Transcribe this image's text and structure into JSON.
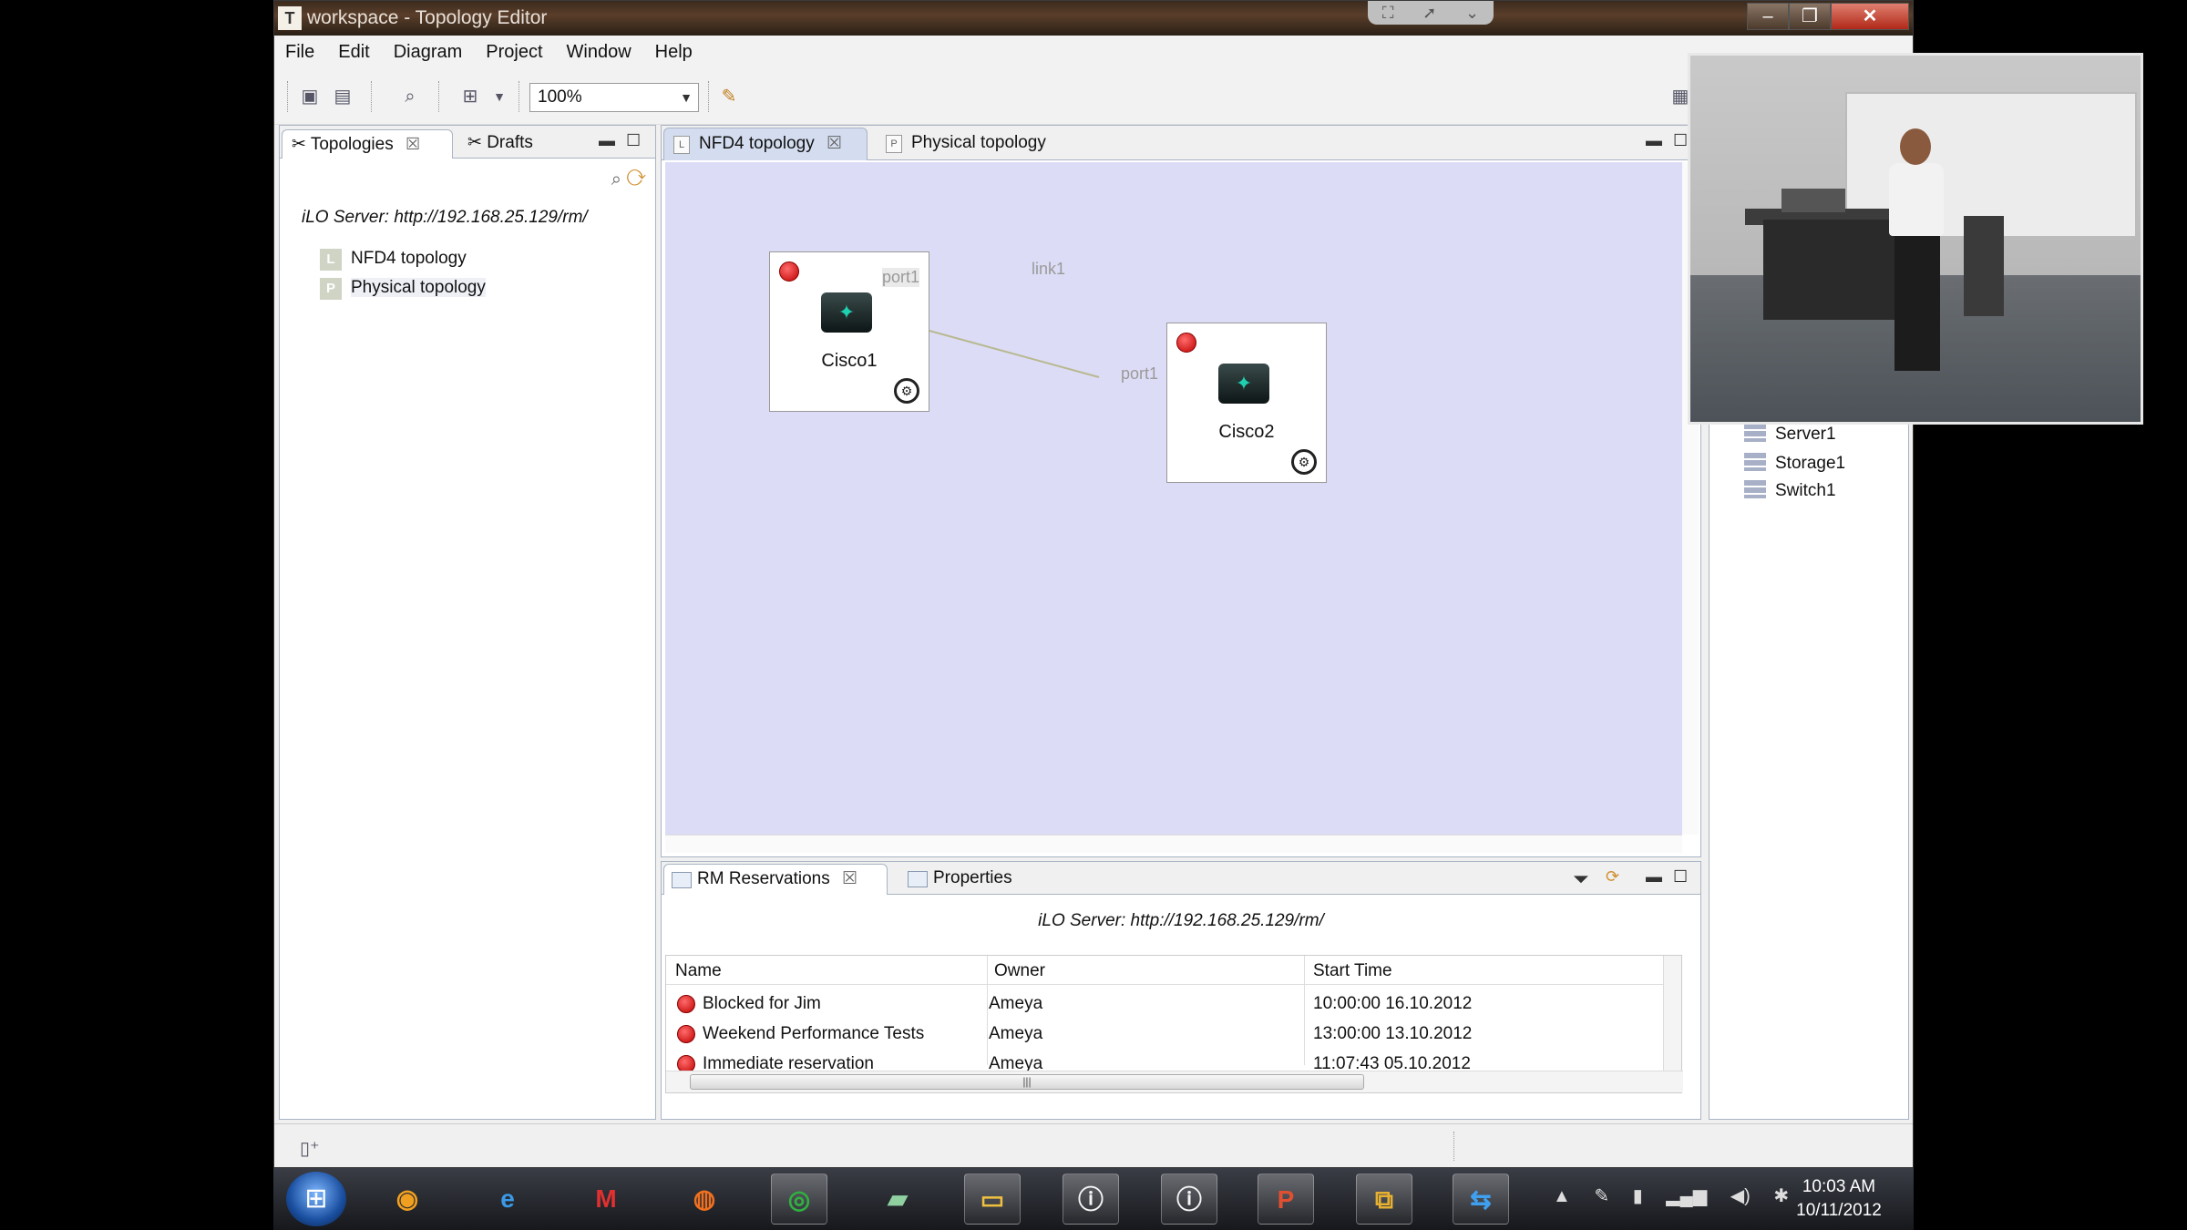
{
  "window": {
    "title": "workspace - Topology Editor",
    "app_icon": "T"
  },
  "menu": [
    "File",
    "Edit",
    "Diagram",
    "Project",
    "Window",
    "Help"
  ],
  "toolbar": {
    "zoom": "100%"
  },
  "left_panel": {
    "tabs": [
      {
        "label": "Topologies",
        "active": true
      },
      {
        "label": "Drafts",
        "active": false
      }
    ],
    "server_url": "iLO Server: http://192.168.25.129/rm/",
    "tree": [
      {
        "badge": "L",
        "label": "NFD4 topology"
      },
      {
        "badge": "P",
        "label": "Physical topology"
      }
    ]
  },
  "editor": {
    "tabs": [
      {
        "label": "NFD4 topology",
        "active": true
      },
      {
        "label": "Physical topology",
        "active": false
      }
    ],
    "nodes": [
      {
        "name": "Cisco1"
      },
      {
        "name": "Cisco2"
      }
    ],
    "ports": [
      "port1",
      "port1"
    ],
    "link_label": "link1"
  },
  "bottom_panel": {
    "tabs": [
      {
        "label": "RM Reservations",
        "active": true
      },
      {
        "label": "Properties",
        "active": false
      }
    ],
    "server_url": "iLO Server: http://192.168.25.129/rm/",
    "columns": [
      "Name",
      "Owner",
      "Start Time"
    ],
    "rows": [
      {
        "name": "Blocked for Jim",
        "owner": "Ameya",
        "start": "10:00:00 16.10.2012"
      },
      {
        "name": "Weekend Performance Tests",
        "owner": "Ameya",
        "start": "13:00:00 13.10.2012"
      },
      {
        "name": "Immediate reservation",
        "owner": "Ameya",
        "start": "11:07:43 05.10.2012"
      }
    ]
  },
  "right_panel": {
    "items": [
      "Server1",
      "Storage1",
      "Switch1"
    ]
  },
  "taskbar": {
    "apps": [
      "outlook-icon",
      "internet-explorer-icon",
      "gmail-icon",
      "firefox-icon",
      "chrome-icon",
      "notepad-icon",
      "file-explorer-icon",
      "topology-editor-icon",
      "topology-editor-icon-2",
      "powerpoint-icon",
      "vmware-icon",
      "teamviewer-icon"
    ],
    "time": "10:03 AM",
    "date": "10/11/2012"
  }
}
